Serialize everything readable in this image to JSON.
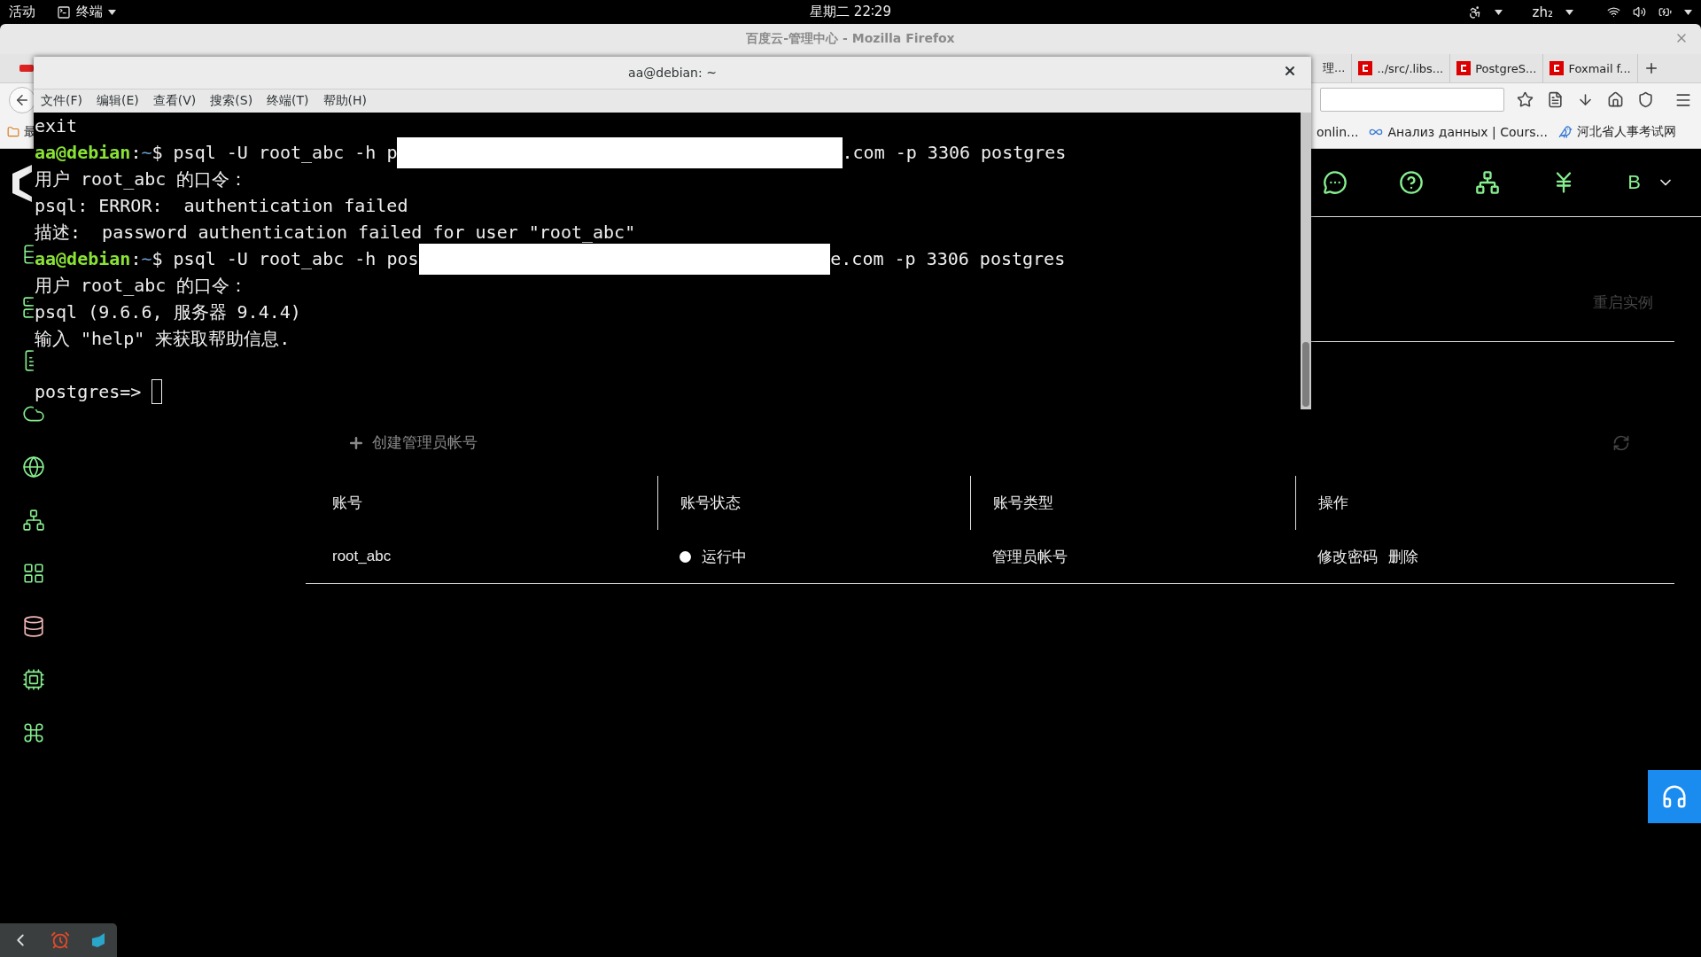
{
  "top_bar": {
    "activities": "活动",
    "app_menu": "终端",
    "clock": "星期二 22∶29",
    "input_method": "zh₂"
  },
  "firefox": {
    "title": "百度云-管理中心 - Mozilla Firefox",
    "tabs": [
      {
        "label": "理..."
      },
      {
        "label": "../src/.libs..."
      },
      {
        "label": "PostgreS..."
      },
      {
        "label": "Foxmail f..."
      }
    ],
    "bookmarks_left": [
      {
        "label": "最"
      }
    ],
    "bookmarks_right": [
      {
        "label": "onlin..."
      },
      {
        "label": "Анализ данных | Cours..."
      },
      {
        "label": "河北省人事考试网"
      }
    ]
  },
  "page": {
    "user_initial": "B",
    "restart_button": "重启实例",
    "create_button": "创建管理员帐号",
    "table": {
      "columns": [
        "账号",
        "账号状态",
        "账号类型",
        "操作"
      ],
      "rows": [
        {
          "account": "root_abc",
          "status": "运行中",
          "type": "管理员帐号",
          "actions": [
            "修改密码",
            "删除"
          ]
        }
      ]
    }
  },
  "terminal": {
    "title": "aa@debian: ~",
    "menu": [
      "文件(F)",
      "编辑(E)",
      "查看(V)",
      "搜索(S)",
      "终端(T)",
      "帮助(H)"
    ],
    "lines": [
      {
        "kind": "output",
        "text": "exit"
      },
      {
        "kind": "command",
        "user": "aa@debian",
        "sep": ":",
        "path": "~",
        "sign": "$",
        "text": " psql -U root_abc -h p",
        "redacted": true,
        "after": ".com -p 3306 postgres"
      },
      {
        "kind": "output",
        "text": "用户 root_abc 的口令："
      },
      {
        "kind": "output",
        "text": "psql: ERROR:  authentication failed"
      },
      {
        "kind": "output",
        "text": "描述:  password authentication failed for user \"root_abc\""
      },
      {
        "kind": "command",
        "user": "aa@debian",
        "sep": ":",
        "path": "~",
        "sign": "$",
        "text": " psql -U root_abc -h pos",
        "redacted": true,
        "after": "e.com -p 3306 postgres"
      },
      {
        "kind": "output",
        "text": "用户 root_abc 的口令："
      },
      {
        "kind": "output",
        "text": "psql (9.6.6, 服务器 9.4.4)"
      },
      {
        "kind": "output",
        "text": "输入 \"help\" 来获取帮助信息."
      },
      {
        "kind": "blank"
      },
      {
        "kind": "input",
        "text": "postgres=> "
      }
    ]
  }
}
